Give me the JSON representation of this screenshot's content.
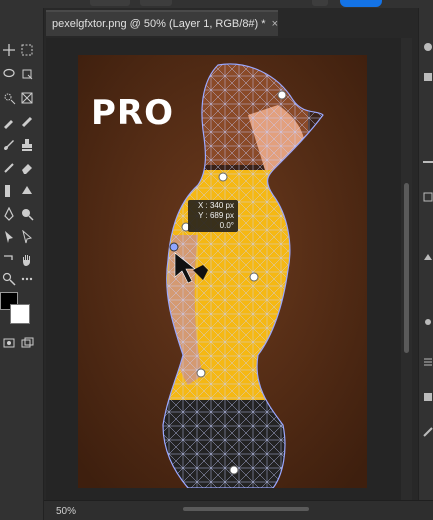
{
  "document": {
    "tab_title": "pexelgfxtor.png @ 50% (Layer 1, RGB/8#) *",
    "close_glyph": "×"
  },
  "canvas": {
    "overlay_text": "PRO",
    "accent_color": "#1473e6",
    "mesh_color": "#b9c3ff",
    "shirt_color": "#f5b814",
    "background_color": "#5a2e17"
  },
  "transform_readout": {
    "x": "X : 340 px",
    "y": "Y : 689 px",
    "angle": "0.0°"
  },
  "status": {
    "zoom": "50%"
  },
  "toolbar": {
    "tools": [
      "marquee-icon",
      "lasso-icon",
      "artboard-icon",
      "frame-icon",
      "eyedropper-icon",
      "brush-icon",
      "stamp-icon",
      "eraser-icon",
      "bucket-icon",
      "dodge-icon",
      "pen-icon",
      "type-icon",
      "path-select-icon",
      "rectangle-icon",
      "hand-icon",
      "zoom-icon",
      "more-icon"
    ]
  }
}
